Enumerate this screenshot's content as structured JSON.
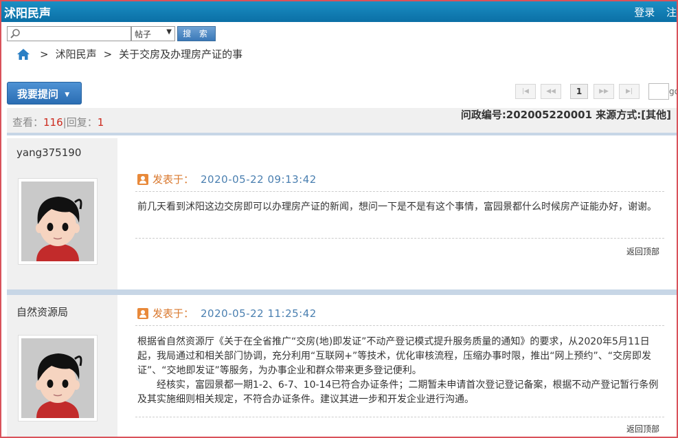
{
  "header": {
    "site_name": "沭阳民声",
    "login": "登录",
    "register": "注"
  },
  "search": {
    "query": "",
    "placeholder": "",
    "type_selected": "帖子",
    "button": "搜 索"
  },
  "breadcrumb": {
    "items": [
      "沭阳民声",
      "关于交房及办理房产证的事"
    ],
    "sep": ">"
  },
  "toolbar": {
    "ask_label": "我要提问"
  },
  "pager": {
    "first": "|◀",
    "prev": "◀◀",
    "current": "1",
    "next": "▶▶",
    "last": "▶|",
    "go": "go"
  },
  "stats": {
    "view_label": "查看：",
    "views": "116",
    "sep": "|",
    "reply_label": "回复：",
    "replies": "1"
  },
  "case": {
    "text": "问政编号:202005220001 来源方式:[其他]"
  },
  "posts": [
    {
      "user": "yang375190",
      "posted_label": "发表于：",
      "time": "2020-05-22 09:13:42",
      "content": [
        "前几天看到沭阳这边交房即可以办理房产证的新闻，想问一下是不是有这个事情，富园景都什么时候房产证能办好，谢谢。"
      ],
      "back_top": "返回顶部"
    },
    {
      "user": "自然资源局",
      "posted_label": "发表于：",
      "time": "2020-05-22 11:25:42",
      "content": [
        "根据省自然资源厅《关于在全省推广“交房(地)即发证”不动产登记模式提升服务质量的通知》的要求，从2020年5月11日起，我局通过和相关部门协调，充分利用“互联网+”等技术，优化审核流程，压缩办事时限，推出“网上预约”、“交房即发证”、“交地即发证”等服务，为办事企业和群众带来更多登记便利。",
        "经核实，富园景都一期1-2、6-7、10-14已符合办证条件；二期暂未申请首次登记登记备案，根据不动产登记暂行条例及其实施细则相关规定，不符合办证条件。建议其进一步和开发企业进行沟通。"
      ],
      "back_top": "返回顶部"
    }
  ],
  "colors": {
    "header": "#0b6fa6",
    "accent_red": "#cc2a1e",
    "link_blue": "#4a7fb0",
    "frame": "#d9525a"
  }
}
